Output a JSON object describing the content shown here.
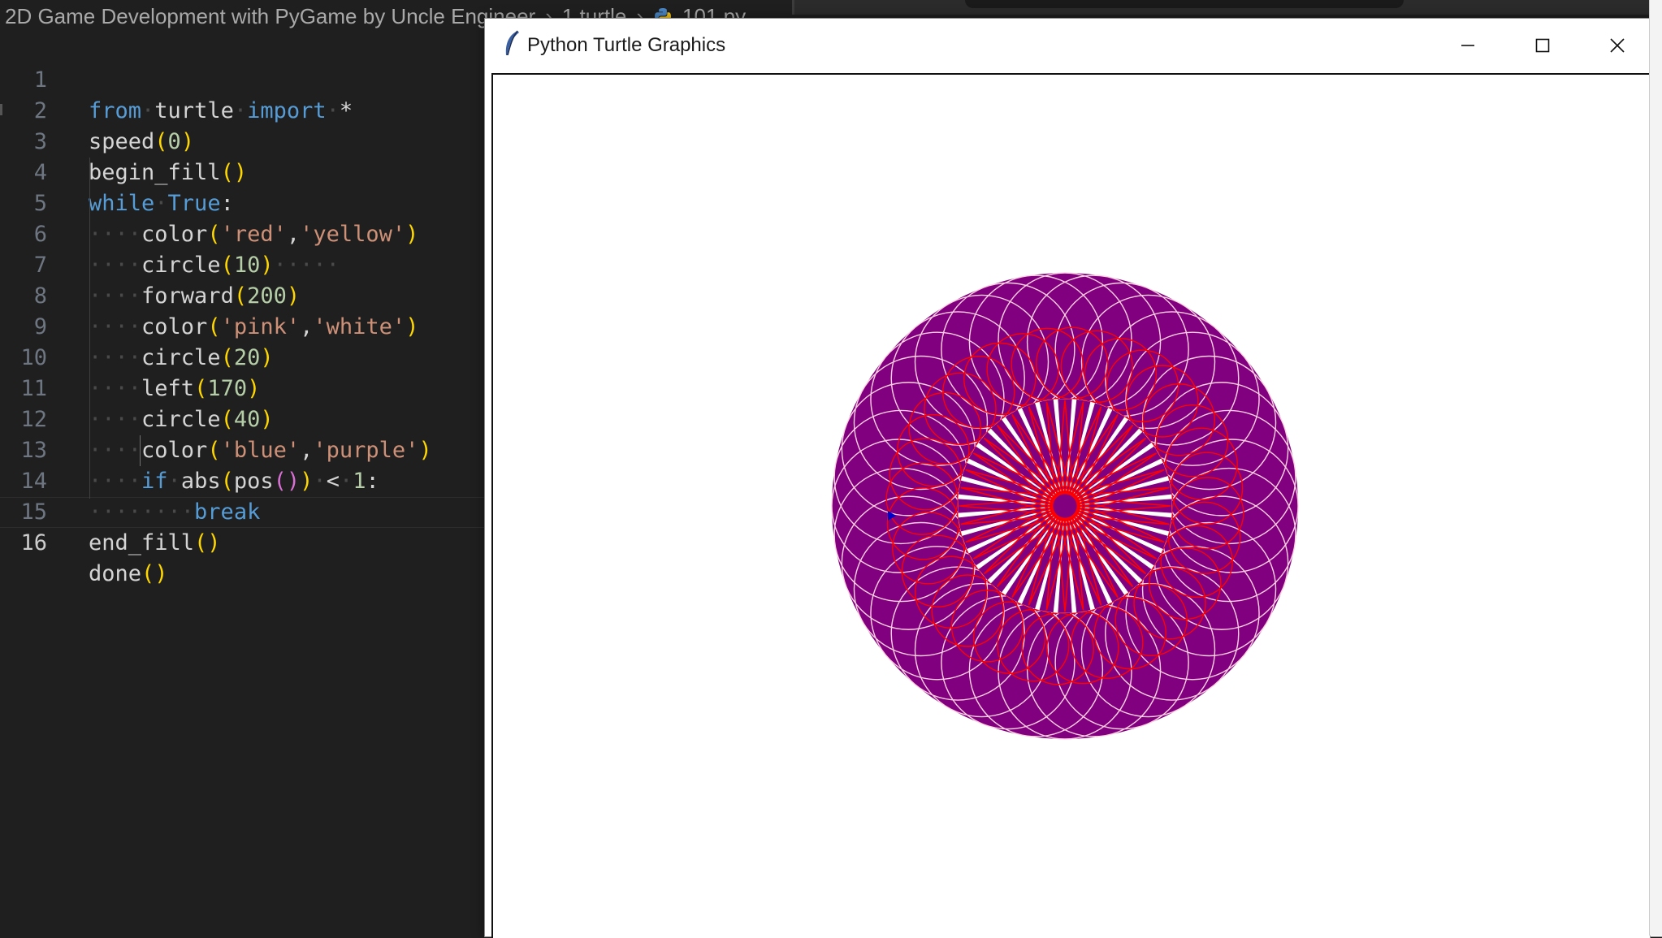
{
  "breadcrumb": {
    "items": [
      "2D Game Development with PyGame by Uncle Engineer",
      "1 turtle",
      "101.py"
    ]
  },
  "editor": {
    "active_line": 16,
    "lines": [
      {
        "n": "1"
      },
      {
        "n": "2"
      },
      {
        "n": "3"
      },
      {
        "n": "4"
      },
      {
        "n": "5"
      },
      {
        "n": "6"
      },
      {
        "n": "7"
      },
      {
        "n": "8"
      },
      {
        "n": "9"
      },
      {
        "n": "10"
      },
      {
        "n": "11"
      },
      {
        "n": "12"
      },
      {
        "n": "13"
      },
      {
        "n": "14"
      },
      {
        "n": "15"
      },
      {
        "n": "16"
      }
    ],
    "tokens": {
      "l1": [
        "from",
        "turtle",
        "import",
        "*"
      ],
      "l2": [
        "speed",
        "(",
        "0",
        ")"
      ],
      "l3": [
        "begin_fill",
        "()"
      ],
      "l4": [
        "while",
        "True",
        ":"
      ],
      "l5": [
        "color",
        "(",
        "'red'",
        ",",
        "'yellow'",
        ")"
      ],
      "l6": [
        "circle",
        "(",
        "10",
        ")"
      ],
      "l7": [
        "forward",
        "(",
        "200",
        ")"
      ],
      "l8": [
        "color",
        "(",
        "'pink'",
        ",",
        "'white'",
        ")"
      ],
      "l9": [
        "circle",
        "(",
        "20",
        ")"
      ],
      "l10": [
        "left",
        "(",
        "170",
        ")"
      ],
      "l11": [
        "circle",
        "(",
        "40",
        ")"
      ],
      "l12": [
        "color",
        "(",
        "'blue'",
        ",",
        "'purple'",
        ")"
      ],
      "l13": [
        "if",
        "abs",
        "(",
        "pos",
        "()",
        ")",
        "<",
        "1",
        ":"
      ],
      "l14": [
        "break"
      ],
      "l15": [
        "end_fill",
        "()"
      ],
      "l16": [
        "done",
        "()"
      ]
    }
  },
  "turtle_window": {
    "title": "Python Turtle Graphics",
    "icon": "feather-icon",
    "buttons": [
      "minimize-icon",
      "maximize-icon",
      "close-icon"
    ]
  },
  "drawing": {
    "fill_color": "#800080",
    "stroke_outer": "#ffd0e0",
    "stroke_inner": "#ff0000",
    "background": "#ffffff"
  }
}
